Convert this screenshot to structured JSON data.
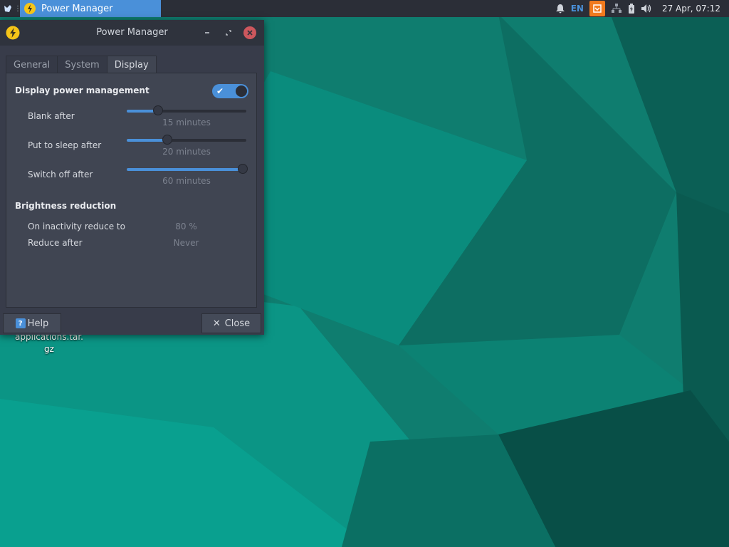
{
  "panel": {
    "task_title": "Power Manager",
    "lang": "EN",
    "clock": "27 Apr, 07:12"
  },
  "desktop": {
    "file_label_line1": "applications.tar.",
    "file_label_line2": "gz"
  },
  "window": {
    "title": "Power Manager",
    "tabs": [
      {
        "label": "General"
      },
      {
        "label": "System"
      },
      {
        "label": "Display"
      }
    ],
    "display": {
      "section_title": "Display power management",
      "toggle_on": true,
      "sliders": [
        {
          "label": "Blank after",
          "value_text": "15 minutes",
          "fraction": 0.26
        },
        {
          "label": "Put to sleep after",
          "value_text": "20 minutes",
          "fraction": 0.34
        },
        {
          "label": "Switch off after",
          "value_text": "60 minutes",
          "fraction": 1.0
        }
      ],
      "brightness_title": "Brightness reduction",
      "inactivity_label": "On inactivity reduce to",
      "inactivity_value": "80 %",
      "reduce_after_label": "Reduce after",
      "reduce_after_value": "Never"
    },
    "help_label": "Help",
    "close_label": "Close"
  },
  "colors": {
    "accent": "#4a90d9",
    "panel_bg": "#2b2e37",
    "window_bg": "#383c4a",
    "close_red": "#cc575d",
    "tray_orange": "#f07a1e"
  },
  "icons": {
    "app": "power-bolt-icon",
    "menu": "whisker-menu-icon",
    "notification": "bell-icon",
    "network": "network-icon",
    "battery": "battery-icon",
    "volume": "volume-icon"
  }
}
